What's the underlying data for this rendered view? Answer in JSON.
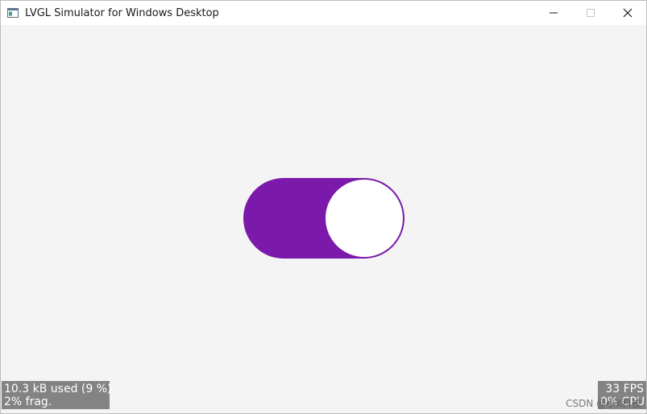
{
  "window": {
    "title": "LVGL Simulator for Windows Desktop",
    "controls": {
      "minimize_icon": "minimize-icon",
      "maximize_icon": "maximize-icon",
      "close_icon": "close-icon"
    }
  },
  "switch": {
    "state": "on",
    "indicator_color": "#7b19ab",
    "knob_color": "#ffffff"
  },
  "monitor": {
    "memory_used": "10.3 kB used (9 %)",
    "fragmentation": "2% frag.",
    "fps": "33 FPS",
    "cpu": "0% CPU"
  },
  "watermark": "CSDN @小K科技",
  "colors": {
    "background": "#f4f4f4",
    "accent": "#7b19ab",
    "overlay": "#6e6e6e"
  }
}
